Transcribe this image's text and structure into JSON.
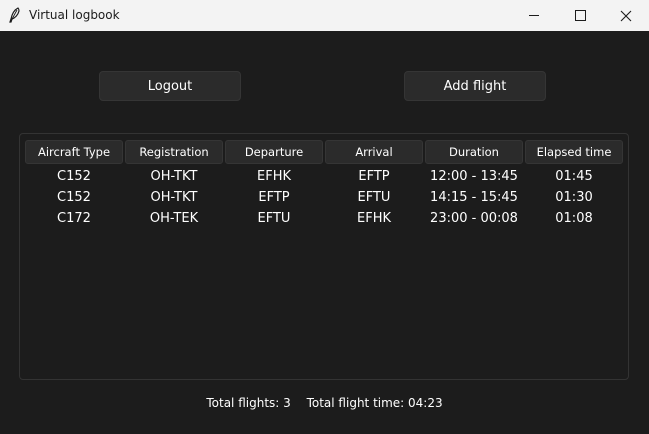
{
  "window": {
    "title": "Virtual logbook"
  },
  "actions": {
    "logout_label": "Logout",
    "add_flight_label": "Add flight"
  },
  "table": {
    "headers": [
      "Aircraft Type",
      "Registration",
      "Departure",
      "Arrival",
      "Duration",
      "Elapsed time"
    ],
    "rows": [
      [
        "C152",
        "OH-TKT",
        "EFHK",
        "EFTP",
        "12:00 - 13:45",
        "01:45"
      ],
      [
        "C152",
        "OH-TKT",
        "EFTP",
        "EFTU",
        "14:15 - 15:45",
        "01:30"
      ],
      [
        "C172",
        "OH-TEK",
        "EFTU",
        "EFHK",
        "23:00 - 00:08",
        "01:08"
      ]
    ]
  },
  "summary": {
    "total_flights": "Total flights: 3",
    "total_time": "Total flight time: 04:23"
  },
  "icons": {
    "app": "feather-icon",
    "minimize": "minimize-icon",
    "maximize": "maximize-icon",
    "close": "close-icon"
  }
}
